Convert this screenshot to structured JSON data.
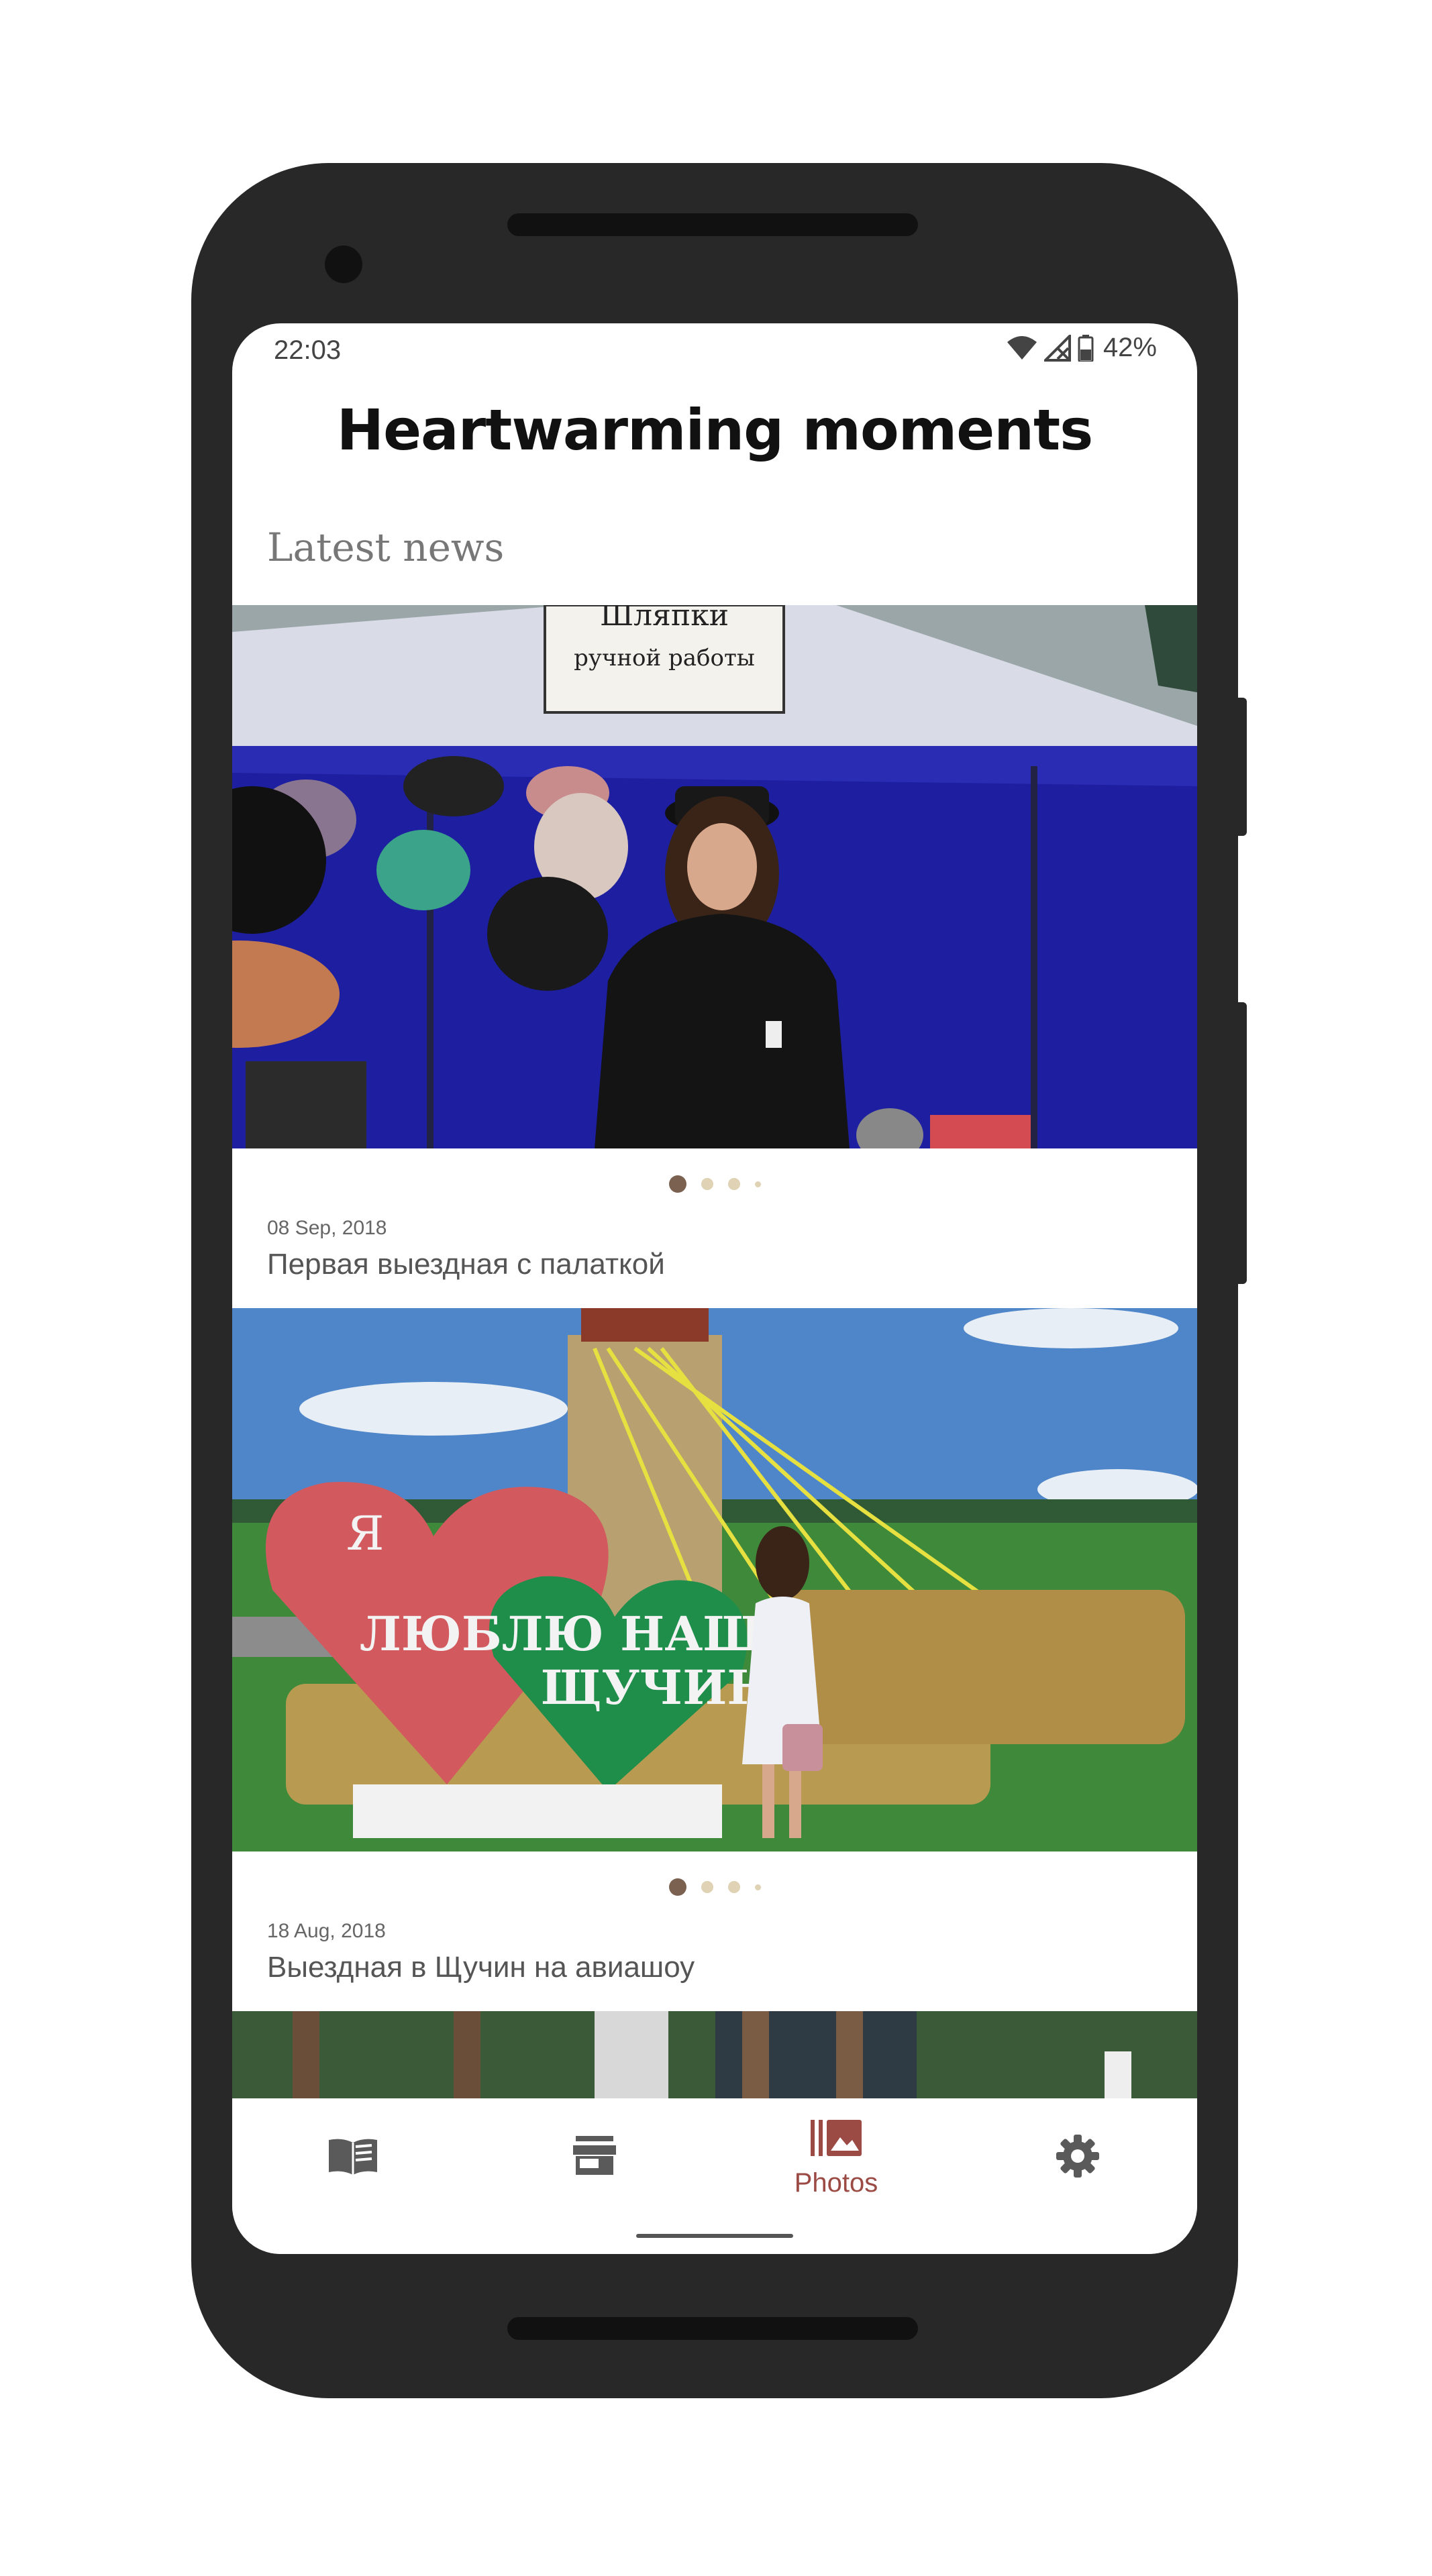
{
  "status_bar": {
    "time": "22:03",
    "battery": "42%",
    "icons": [
      "wifi-icon",
      "signal-off-icon",
      "battery-icon"
    ]
  },
  "header": {
    "title": "Heartwarming moments"
  },
  "section": {
    "title": "Latest news"
  },
  "news": [
    {
      "date": "08 Sep, 2018",
      "title": "Первая выездная с палаткой",
      "photo_sign_line1": "Шляпки",
      "photo_sign_line2": "ручной работы",
      "carousel_pages": 4,
      "carousel_active": 1
    },
    {
      "date": "18 Aug, 2018",
      "title": "Выездная в Щучин на авиашоу",
      "photo_heart_text_1": "Я",
      "photo_heart_text_2": "ЛЮБЛЮ НАШ",
      "photo_heart_text_3": "ЩУЧИН!",
      "carousel_pages": 4,
      "carousel_active": 1
    }
  ],
  "bottom_nav": {
    "items": [
      {
        "icon": "book-icon",
        "label": "",
        "active": false
      },
      {
        "icon": "store-icon",
        "label": "",
        "active": false
      },
      {
        "icon": "photos-icon",
        "label": "Photos",
        "active": true
      },
      {
        "icon": "gear-icon",
        "label": "",
        "active": false
      }
    ]
  },
  "colors": {
    "accent": "#9b4a44",
    "dot_active": "#7a6150",
    "dot_inactive": "#e0d2b4",
    "frame": "#282828"
  }
}
